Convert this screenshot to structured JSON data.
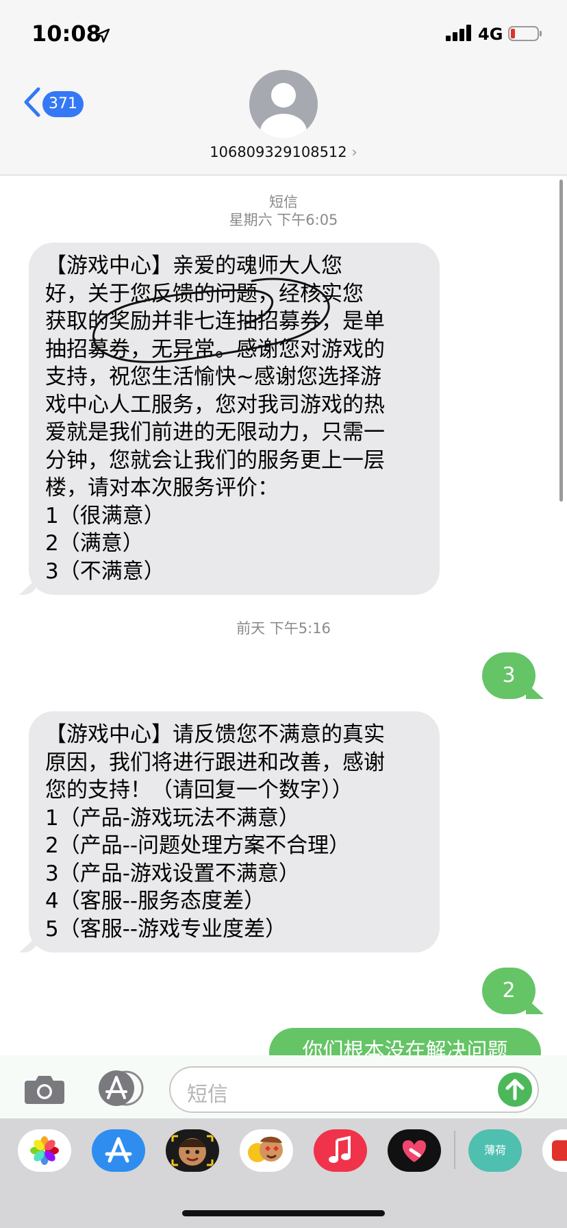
{
  "status_bar": {
    "time": "10:08",
    "network": "4G",
    "icons": [
      "location-arrow-icon",
      "signal-icon",
      "battery-low-icon"
    ]
  },
  "nav": {
    "back_count": "371",
    "contact": "106809329108512",
    "chevron": "›"
  },
  "thread": {
    "meta1_type": "短信",
    "meta1_time": "星期六 下午6:05",
    "msg1": [
      "【游戏中心】亲爱的魂师大人您",
      "好，关于您反馈的问题，经核实您",
      "获取的奖励并非七连抽招募券，是单",
      "抽招募券，无异常。感谢您对游戏的",
      "支持，祝您生活愉快~感谢您选择游",
      "戏中心人工服务，您对我司游戏的热",
      "爱就是我们前进的无限动力，只需一",
      "分钟，您就会让我们的服务更上一层",
      "楼，请对本次服务评价：",
      "1（很满意）",
      "2（满意）",
      "3（不满意）"
    ],
    "meta2_time": "前天 下午5:16",
    "reply1": "3",
    "msg2": [
      "【游戏中心】请反馈您不满意的真实",
      "原因，我们将进行跟进和改善，感谢",
      "您的支持！（请回复一个数字））",
      "1（产品-游戏玩法不满意）",
      "2（产品--问题处理方案不合理）",
      "3（产品-游戏设置不满意）",
      "4（客服--服务态度差）",
      "5（客服--游戏专业度差）"
    ],
    "reply2": "2",
    "reply3": "你们根本没在解决问题"
  },
  "input": {
    "placeholder": "短信"
  },
  "apps": {
    "mint_label": "薄荷",
    "items": [
      "photos-icon",
      "app-store-icon",
      "memoji-icon",
      "animoji-icon",
      "music-icon",
      "digital-touch-icon",
      "mint-app-icon",
      "red-app-icon"
    ]
  },
  "colors": {
    "accent_blue": "#3478f6",
    "sent_green": "#65c466",
    "received_gray": "#e9e9eb"
  }
}
